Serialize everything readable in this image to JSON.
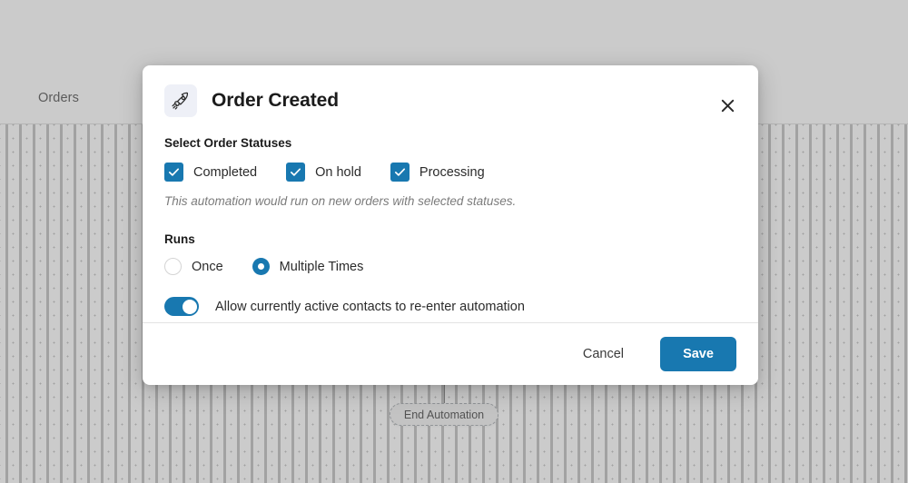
{
  "background": {
    "tab_label": "Orders",
    "end_node_label": "End Automation"
  },
  "modal": {
    "title": "Order Created",
    "trigger_icon": "rocket-icon",
    "close_icon": "close-icon",
    "accent_color": "#1878b0",
    "status_section": {
      "label": "Select Order Statuses",
      "helper_text": "This automation would run on new orders with selected statuses.",
      "options": [
        {
          "label": "Completed",
          "checked": true
        },
        {
          "label": "On hold",
          "checked": true
        },
        {
          "label": "Processing",
          "checked": true
        }
      ]
    },
    "runs_section": {
      "label": "Runs",
      "options": [
        {
          "label": "Once",
          "selected": false
        },
        {
          "label": "Multiple Times",
          "selected": true
        }
      ]
    },
    "reenter_toggle": {
      "label": "Allow currently active contacts to re-enter automation",
      "enabled": true
    },
    "footer": {
      "cancel_label": "Cancel",
      "save_label": "Save"
    }
  }
}
